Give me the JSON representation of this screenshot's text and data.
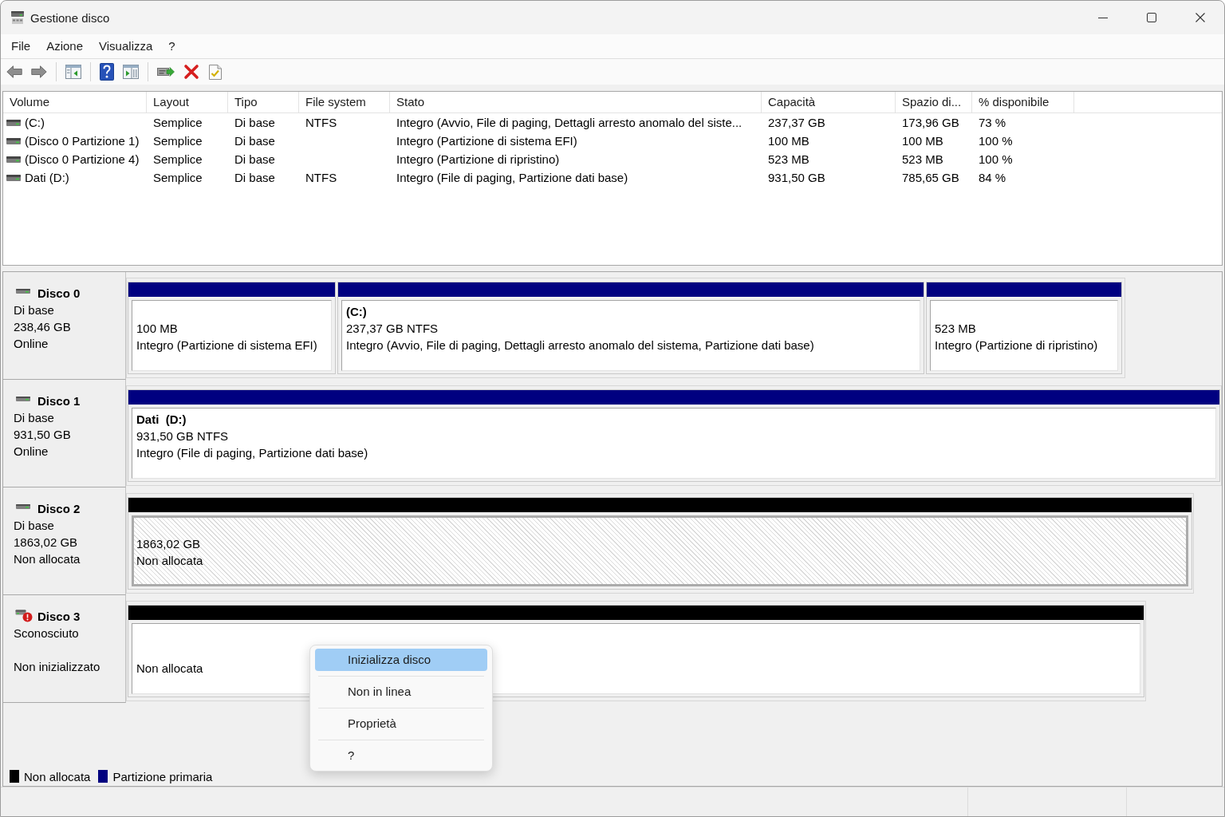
{
  "window": {
    "title": "Gestione disco"
  },
  "menu_bar": [
    "File",
    "Azione",
    "Visualizza",
    "?"
  ],
  "volume_table": {
    "columns": [
      "Volume",
      "Layout",
      "Tipo",
      "File system",
      "Stato",
      "Capacità",
      "Spazio di...",
      "% disponibile"
    ],
    "rows": [
      {
        "volume": "(C:)",
        "layout": "Semplice",
        "type": "Di base",
        "file_system": "NTFS",
        "status": "Integro (Avvio, File di paging, Dettagli arresto anomalo del siste...",
        "capacity": "237,37 GB",
        "free_space": "173,96 GB",
        "percent_free": "73 %"
      },
      {
        "volume": "(Disco 0 Partizione 1)",
        "layout": "Semplice",
        "type": "Di base",
        "status": "Integro (Partizione di sistema EFI)",
        "capacity": "100 MB",
        "free_space": "100 MB",
        "percent_free": "100 %"
      },
      {
        "volume": "(Disco 0 Partizione 4)",
        "layout": "Semplice",
        "type": "Di base",
        "status": "Integro (Partizione di ripristino)",
        "capacity": "523 MB",
        "free_space": "523 MB",
        "percent_free": "100 %"
      },
      {
        "volume": "Dati (D:)",
        "layout": "Semplice",
        "type": "Di base",
        "file_system": "NTFS",
        "status": "Integro (File di paging, Partizione dati base)",
        "capacity": "931,50 GB",
        "free_space": "785,65 GB",
        "percent_free": "84 %"
      }
    ]
  },
  "disks": [
    {
      "name": "Disco 0",
      "type": "Di base",
      "size": "238,46 GB",
      "status": "Online",
      "error": false,
      "partitions": [
        {
          "kind": "primary",
          "size": "100 MB",
          "status": "Integro (Partizione di sistema EFI)",
          "selected": false
        },
        {
          "kind": "primary",
          "drive": "(C:)",
          "size": "237,37 GB NTFS",
          "status": "Integro (Avvio, File di paging, Dettagli arresto anomalo del sistema, Partizione dati base)",
          "selected": false
        },
        {
          "kind": "primary",
          "size": "523 MB",
          "status": "Integro (Partizione di ripristino)",
          "selected": false
        }
      ]
    },
    {
      "name": "Disco 1",
      "type": "Di base",
      "size": "931,50 GB",
      "status": "Online",
      "error": false,
      "partitions": [
        {
          "kind": "primary",
          "name": "Dati",
          "drive": "(D:)",
          "size": "931,50 GB NTFS",
          "status": "Integro (File di paging, Partizione dati base)",
          "selected": false
        }
      ]
    },
    {
      "name": "Disco 2",
      "type": "Di base",
      "size": "1863,02 GB",
      "status": "Non allocata",
      "error": false,
      "partitions": [
        {
          "kind": "unallocated",
          "size": "1863,02 GB",
          "status": "Non allocata",
          "selected": true
        }
      ]
    },
    {
      "name": "Disco 3",
      "type": "Sconosciuto",
      "status": "Non inizializzato",
      "error": true,
      "partitions": [
        {
          "kind": "unallocated",
          "status": "Non allocata",
          "selected": false
        }
      ]
    }
  ],
  "legend": [
    {
      "kind": "unallocated",
      "label": "Non allocata",
      "color": "#000000"
    },
    {
      "kind": "primary",
      "label": "Partizione primaria",
      "color": "#000080"
    }
  ],
  "context_menu": {
    "items": [
      {
        "label": "Inizializza disco",
        "selected": true
      },
      {
        "label": "Non in linea",
        "selected": false
      },
      {
        "label": "Proprietà",
        "selected": false
      },
      {
        "label": "?",
        "selected": false
      }
    ]
  }
}
